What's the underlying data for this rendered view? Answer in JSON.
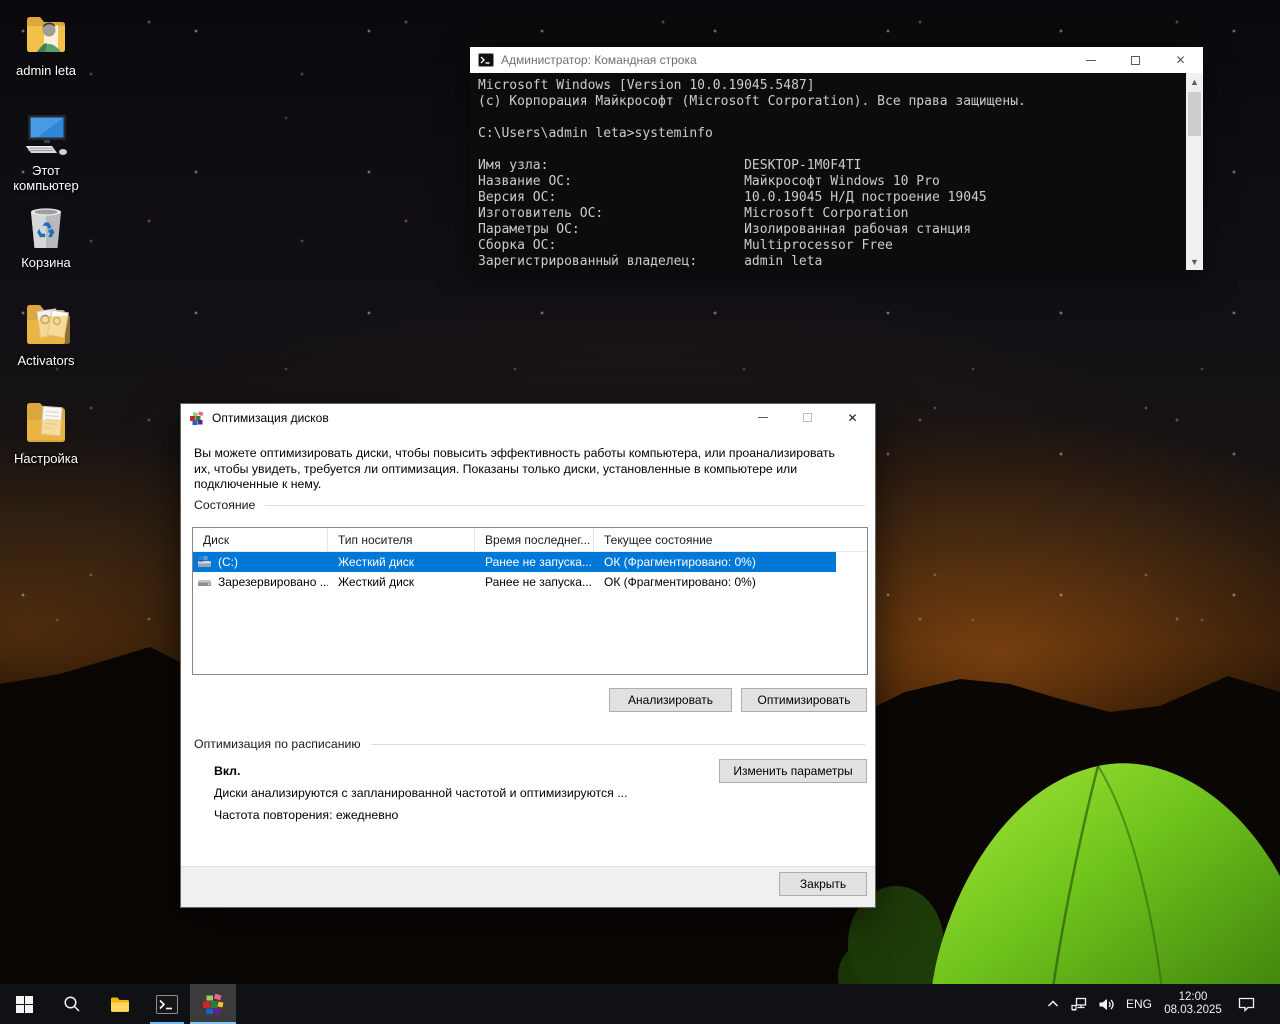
{
  "desktop": {
    "icons": [
      {
        "label": "admin leta",
        "icon": "user-folder-icon"
      },
      {
        "label": "Этот компьютер",
        "icon": "this-pc-icon"
      },
      {
        "label": "Корзина",
        "icon": "recycle-bin-icon"
      },
      {
        "label": "Activators",
        "icon": "folder-gears-icon"
      },
      {
        "label": "Настройка",
        "icon": "folder-document-icon"
      }
    ]
  },
  "cmd": {
    "title": "Администратор: Командная строка",
    "lines": [
      "Microsoft Windows [Version 10.0.19045.5487]",
      "(c) Корпорация Майкрософт (Microsoft Corporation). Все права защищены.",
      "",
      "C:\\Users\\admin leta>systeminfo",
      "",
      "Имя узла:                         DESKTOP-1M0F4TI",
      "Название ОС:                      Майкрософт Windows 10 Pro",
      "Версия ОС:                        10.0.19045 Н/Д построение 19045",
      "Изготовитель ОС:                  Microsoft Corporation",
      "Параметры ОС:                     Изолированная рабочая станция",
      "Сборка ОС:                        Multiprocessor Free",
      "Зарегистрированный владелец:      admin leta"
    ]
  },
  "dialog": {
    "title": "Оптимизация дисков",
    "description": "Вы можете оптимизировать диски, чтобы повысить эффективность работы  компьютера, или проанализировать их, чтобы увидеть, требуется ли оптимизация. Показаны только диски, установленные в компьютере или подключенные к нему.",
    "status_section": "Состояние",
    "table": {
      "headers": [
        "Диск",
        "Тип носителя",
        "Время последнег...",
        "Текущее состояние"
      ],
      "rows": [
        {
          "disk": "(C:)",
          "type": "Жесткий диск",
          "last_run": "Ранее не запуска...",
          "status": "ОК (Фрагментировано: 0%)"
        },
        {
          "disk": "Зарезервировано ...",
          "type": "Жесткий диск",
          "last_run": "Ранее не запуска...",
          "status": "ОК (Фрагментировано: 0%)"
        }
      ]
    },
    "analyze_button": "Анализировать",
    "optimize_button": "Оптимизировать",
    "schedule_section": "Оптимизация по расписанию",
    "schedule_status": "Вкл.",
    "schedule_desc": "Диски анализируются с запланированной частотой и оптимизируются ...",
    "schedule_freq": "Частота повторения: ежедневно",
    "change_params_button": "Изменить параметры",
    "close_button": "Закрыть"
  },
  "taskbar": {
    "items": [
      "start",
      "search",
      "file-explorer",
      "command-prompt",
      "disk-defragmenter"
    ],
    "tray": {
      "language": "ENG",
      "time": "12:00",
      "date": "08.03.2025"
    }
  },
  "colors": {
    "accent": "#0078d7",
    "selection": "#0078d7",
    "task_underline": "#76b9ed",
    "tent_green": "#6fc41c",
    "console_bg": "#0c0c0c"
  }
}
